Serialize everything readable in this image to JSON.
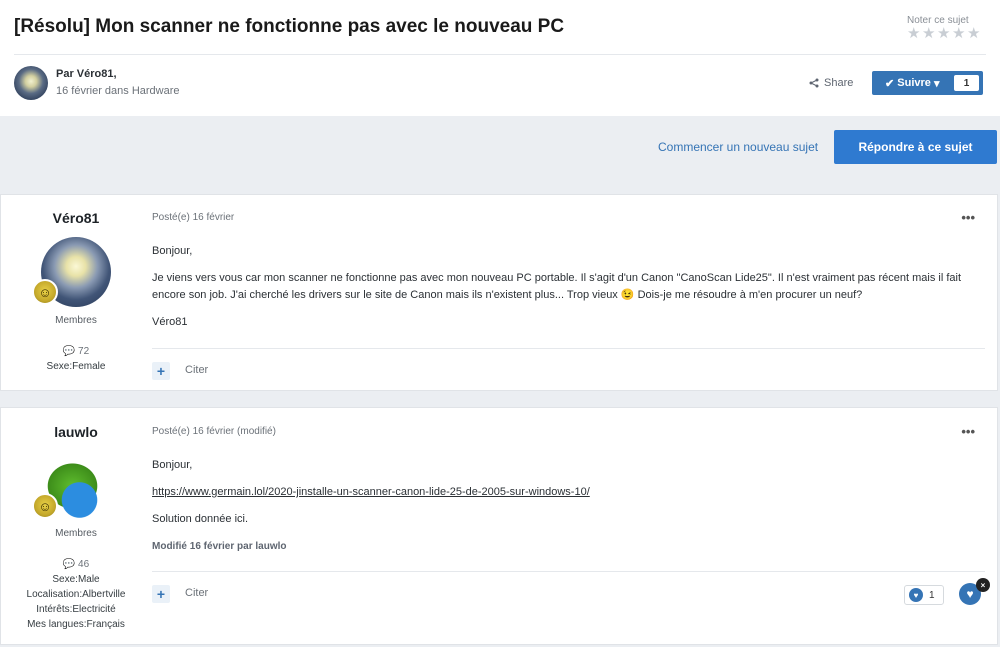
{
  "topic": {
    "title": "[Résolu] Mon scanner ne fonctionne pas avec le nouveau PC",
    "rate_label": "Noter ce sujet",
    "stars": 0,
    "byline": "Par Véro81,",
    "dateline": "16 février dans Hardware",
    "share_label": "Share",
    "follow_label": "Suivre",
    "follow_count": "1"
  },
  "actions": {
    "new_topic": "Commencer un nouveau sujet",
    "reply": "Répondre à ce sujet"
  },
  "posts": [
    {
      "author": "Véro81",
      "group": "Membres",
      "post_count": "72",
      "fields": [
        "Sexe:Female"
      ],
      "posted": "Posté(e) 16 février",
      "more": "•••",
      "lines": [
        "Bonjour,",
        "Je viens vers vous car mon scanner ne fonctionne pas avec mon nouveau PC portable. Il s'agit d'un Canon \"CanoScan Lide25\". Il n'est vraiment pas récent mais il fait encore son job. J'ai cherché les drivers sur le site de Canon mais ils n'existent plus... Trop vieux 😉 Dois-je me résoudre à m'en procurer un neuf?",
        "Véro81"
      ],
      "quote_label": "Citer"
    },
    {
      "author": "lauwlo",
      "group": "Membres",
      "post_count": "46",
      "fields": [
        "Sexe:Male",
        "Localisation:Albertville",
        "Intérêts:Electricité",
        "Mes langues:Français"
      ],
      "posted": "Posté(e) 16 février (modifié)",
      "more": "•••",
      "lines": [
        "Bonjour,",
        "https://www.germain.lol/2020-jinstalle-un-scanner-canon-lide-25-de-2005-sur-windows-10/",
        "Solution donnée ici."
      ],
      "modified": "Modifié 16 février par lauwlo",
      "quote_label": "Citer",
      "reaction_count": "1"
    }
  ],
  "colors": {
    "accent": "#3574b5",
    "reply_button": "#2f7ad0",
    "background": "#ebeef2"
  }
}
